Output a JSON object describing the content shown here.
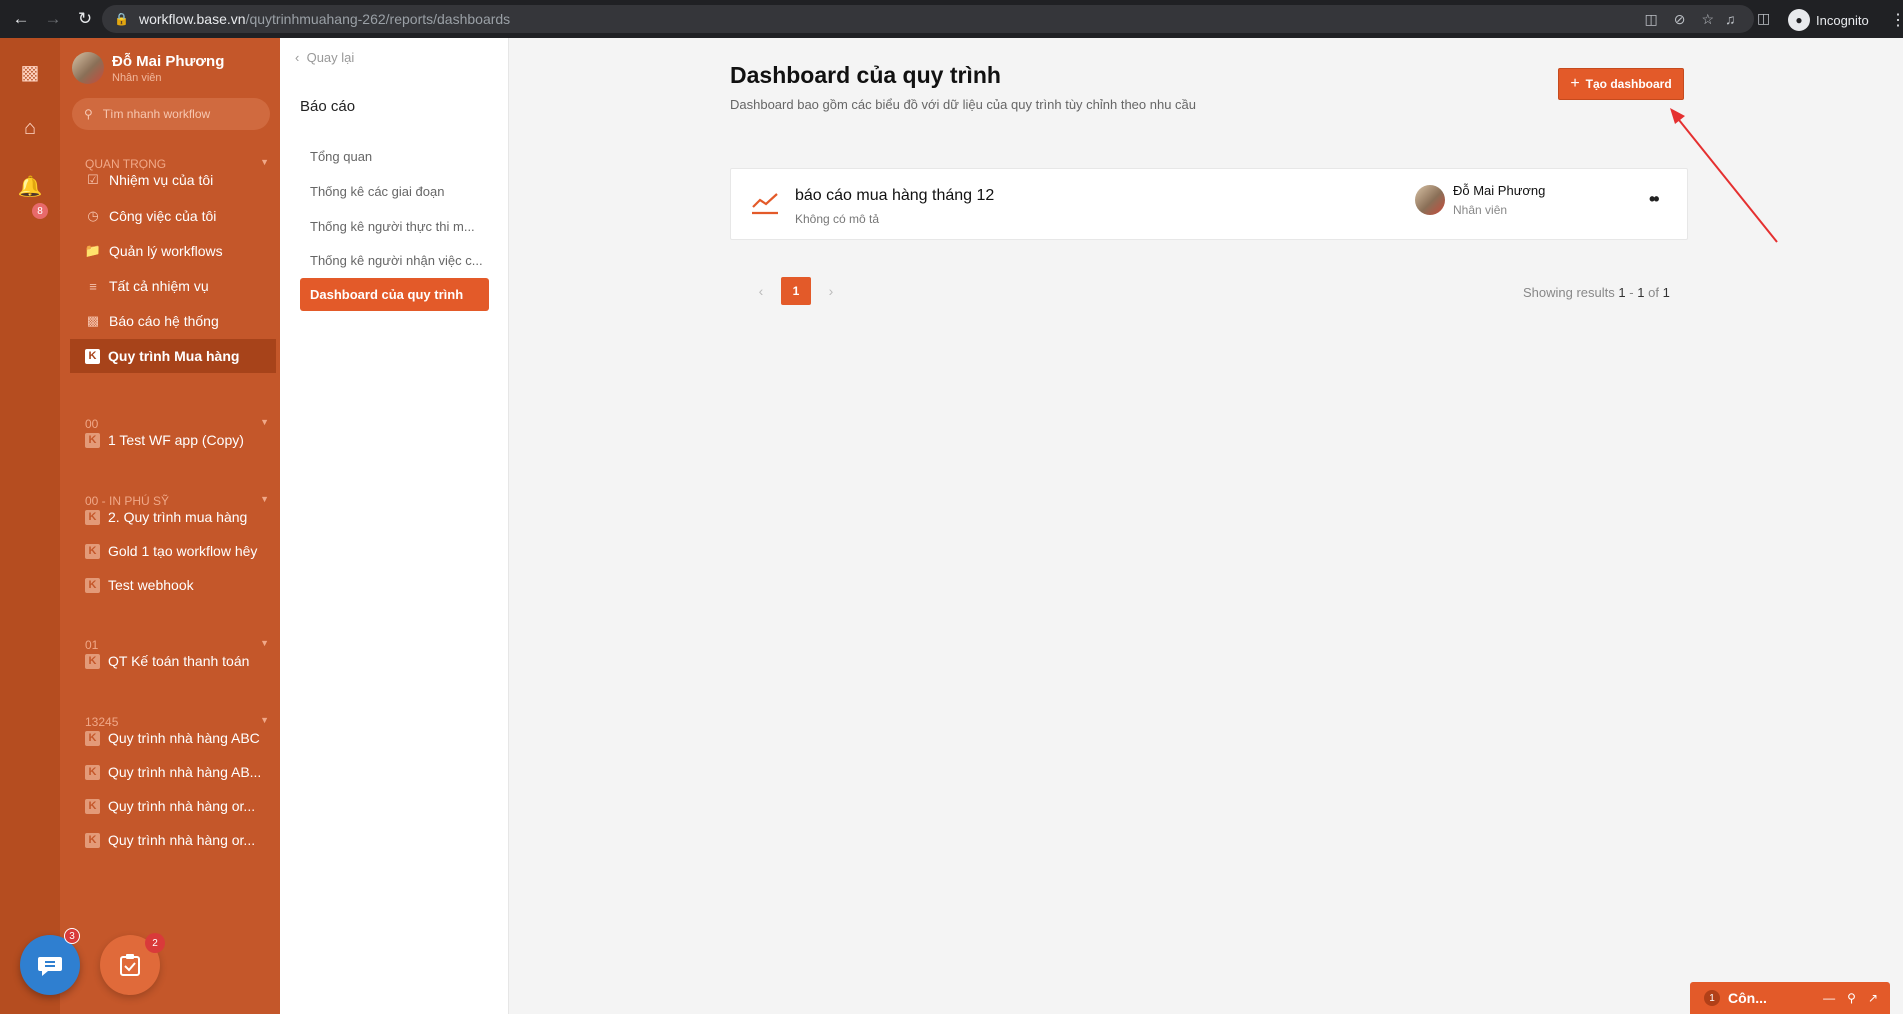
{
  "browser": {
    "url_host": "workflow.base.vn",
    "url_path": "/quytrinhmuahang-262/reports/dashboards",
    "incognito_label": "Incognito"
  },
  "rail": {
    "notification_count": "8"
  },
  "profile": {
    "name": "Đỗ Mai Phương",
    "role": "Nhân viên"
  },
  "search": {
    "placeholder": "Tìm nhanh workflow"
  },
  "sidebar": {
    "sections": [
      {
        "title": "QUAN TRỌNG"
      },
      {
        "title": "00"
      },
      {
        "title": "00 - IN PHÚ SỸ"
      },
      {
        "title": "01"
      },
      {
        "title": "13245"
      }
    ],
    "items": [
      {
        "label": "Nhiệm vụ của tôi"
      },
      {
        "label": "Công việc của tôi"
      },
      {
        "label": "Quản lý workflows"
      },
      {
        "label": "Tất cả nhiệm vụ"
      },
      {
        "label": "Báo cáo hệ thống"
      },
      {
        "label": "Quy trình Mua hàng"
      },
      {
        "label": "1 Test WF app (Copy)"
      },
      {
        "label": "2. Quy trình mua hàng"
      },
      {
        "label": "Gold 1 tạo workflow hêy"
      },
      {
        "label": "Test webhook"
      },
      {
        "label": "QT Kế toán thanh toán"
      },
      {
        "label": "Quy trình nhà hàng ABC"
      },
      {
        "label": "Quy trình nhà hàng AB..."
      },
      {
        "label": "Quy trình nhà hàng or..."
      },
      {
        "label": "Quy trình nhà hàng or..."
      }
    ]
  },
  "submenu": {
    "back_label": "Quay lại",
    "title": "Báo cáo",
    "items": [
      {
        "label": "Tổng quan"
      },
      {
        "label": "Thống kê các giai đoạn"
      },
      {
        "label": "Thống kê người thực thi m..."
      },
      {
        "label": "Thống kê người nhận việc c..."
      },
      {
        "label": "Dashboard của quy trình"
      }
    ]
  },
  "main": {
    "title": "Dashboard của quy trình",
    "description": "Dashboard bao gồm các biểu đồ với dữ liệu của quy trình tùy chỉnh theo nhu cầu",
    "create_label": "Tạo dashboard",
    "dashboard": {
      "title": "báo cáo mua hàng tháng 12",
      "description": "Không có mô tả",
      "owner_name": "Đỗ Mai Phương",
      "owner_role": "Nhân viên"
    },
    "pagination": {
      "current_page": "1",
      "results_prefix": "Showing results",
      "range_start": "1",
      "range_sep": "-",
      "range_end": "1",
      "of_label": "of",
      "total": "1"
    }
  },
  "floating": {
    "chat_badge": "3",
    "task_badge": "2"
  },
  "chat_tab": {
    "count": "1",
    "label": "Côn..."
  },
  "colors": {
    "accent": "#e35a29",
    "sidebar": "#c4572a",
    "rail": "#b54d20"
  }
}
